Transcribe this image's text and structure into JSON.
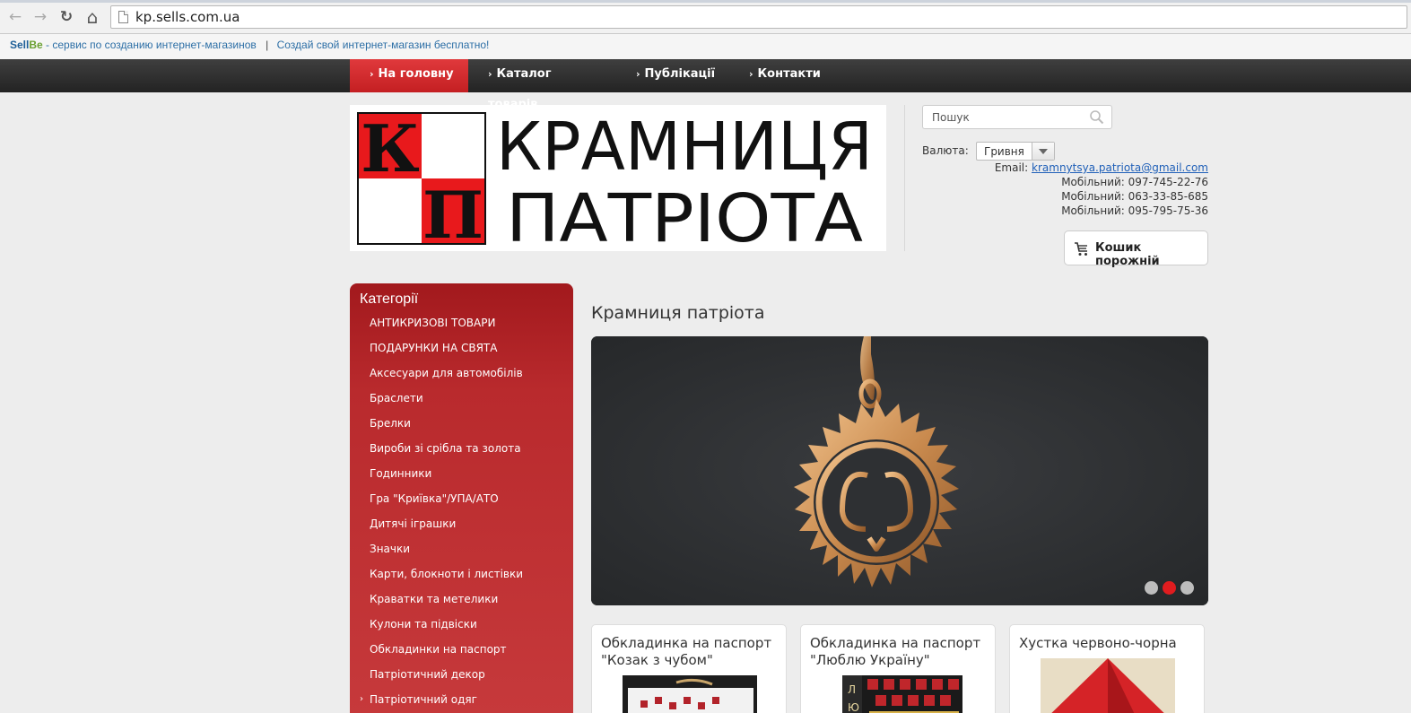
{
  "browser": {
    "url": "kp.sells.com.ua",
    "back_icon": "←",
    "forward_icon": "→",
    "reload_icon": "↻",
    "home_icon": "⌂"
  },
  "sellbe": {
    "brand_part1": "Sell",
    "brand_part2": "Be",
    "tagline": " - сервис по созданию интернет-магазинов",
    "separator": "|",
    "cta": "Создай свой интернет-магазин бесплатно!"
  },
  "nav": {
    "items": [
      {
        "label": "На головну",
        "active": true
      },
      {
        "label": "Каталог товарів",
        "active": false
      },
      {
        "label": "Публікації",
        "active": false
      },
      {
        "label": "Контакти",
        "active": false
      }
    ]
  },
  "logo": {
    "letter1": "К",
    "letter2": "П",
    "line1": "КРАМНИЦЯ",
    "line2": "ПАТРІОТА"
  },
  "search": {
    "placeholder": "Пошук"
  },
  "currency": {
    "label": "Валюта:",
    "value": "Гривня"
  },
  "contacts": {
    "email_label": "Email:",
    "email": "kramnytsya.patriota@gmail.com",
    "phones": [
      "Мобільний: 097-745-22-76",
      "Мобільний: 063-33-85-685",
      "Мобільний: 095-795-75-36"
    ]
  },
  "cart": {
    "label": "Кошик порожній"
  },
  "categories": {
    "title": "Категорії",
    "items": [
      "АНТИКРИЗОВІ ТОВАРИ",
      "ПОДАРУНКИ НА СВЯТА",
      "Аксесуари для автомобілів",
      "Браслети",
      "Брелки",
      "Вироби зі срібла та золота",
      "Годинники",
      "Гра \"Криївка\"/УПА/АТО",
      "Дитячі іграшки",
      "Значки",
      "Карти, блокноти і листівки",
      "Краватки та метелики",
      "Кулони та підвіски",
      "Обкладинки на паспорт",
      "Патріотичний декор",
      "Патріотичний одяг"
    ]
  },
  "main": {
    "title": "Крамниця патріота",
    "slider": {
      "slide_count": 3,
      "active_slide": 2
    },
    "products": [
      {
        "title": "Обкладинка на паспорт \"Козак з чубом\""
      },
      {
        "title": "Обкладинка на паспорт \"Люблю Україну\""
      },
      {
        "title": "Хустка червоно-чорна"
      }
    ]
  },
  "colors": {
    "accent_red": "#c41f22",
    "nav_dark": "#2b2b2b",
    "link_blue": "#2060b8"
  }
}
